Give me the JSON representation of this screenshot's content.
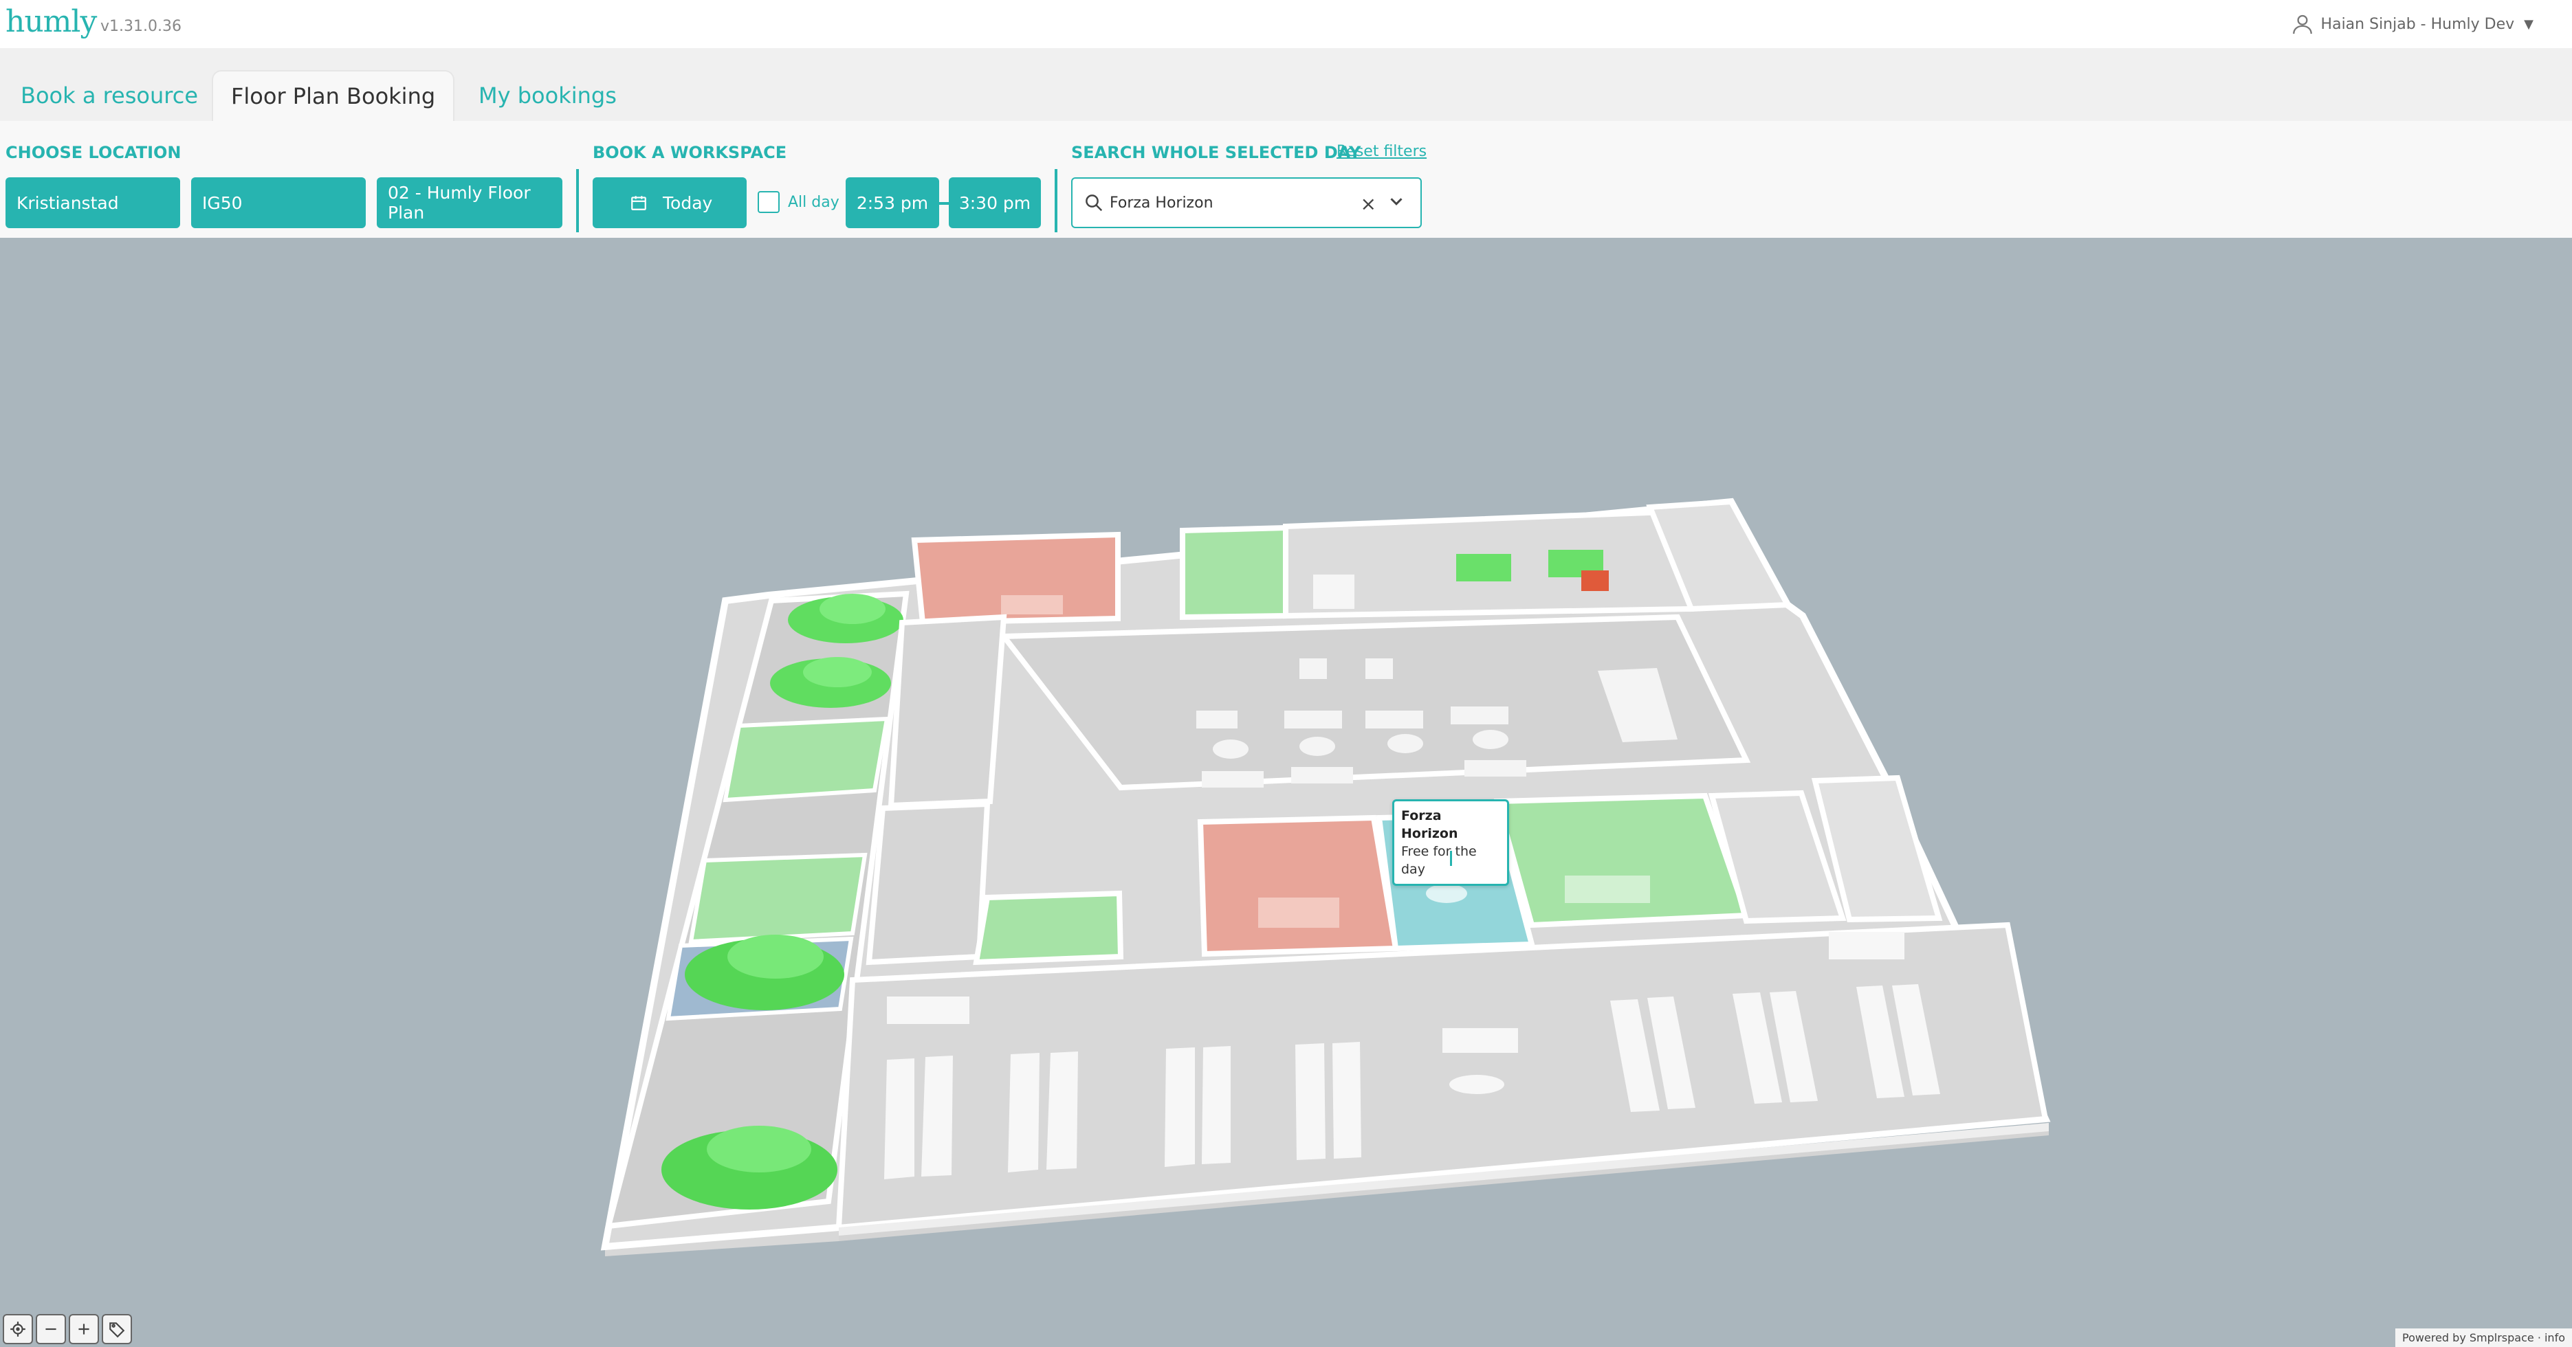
{
  "app": {
    "logo": "humly",
    "version": "v1.31.0.36"
  },
  "user": {
    "name": "Haian Sinjab - Humly Dev"
  },
  "tabs": [
    {
      "label": "Book a resource"
    },
    {
      "label": "Floor Plan Booking"
    },
    {
      "label": "My bookings"
    }
  ],
  "filters": {
    "location": {
      "label": "CHOOSE LOCATION",
      "city": "Kristianstad",
      "building": "IG50",
      "floor": "02 - Humly Floor Plan"
    },
    "workspace": {
      "label": "BOOK A WORKSPACE",
      "date": "Today",
      "all_day_label": "All day",
      "start_time": "2:53 pm",
      "end_time": "3:30 pm"
    },
    "search": {
      "label": "SEARCH WHOLE SELECTED DAY",
      "reset_label": "Reset filters",
      "value": "Forza Horizon"
    }
  },
  "tooltip": {
    "title": "Forza Horizon",
    "status": "Free for the day"
  },
  "colors": {
    "accent": "#27b4b0",
    "free": "#6edc6e",
    "busy": "#e88a7a",
    "selected": "#8ad6da",
    "map_background": "#aab6bd"
  },
  "map_controls": [
    "locate-icon",
    "zoom-out-icon",
    "zoom-in-icon",
    "tag-icon"
  ],
  "footer": {
    "powered_by": "Powered by Smplrspace · info"
  }
}
